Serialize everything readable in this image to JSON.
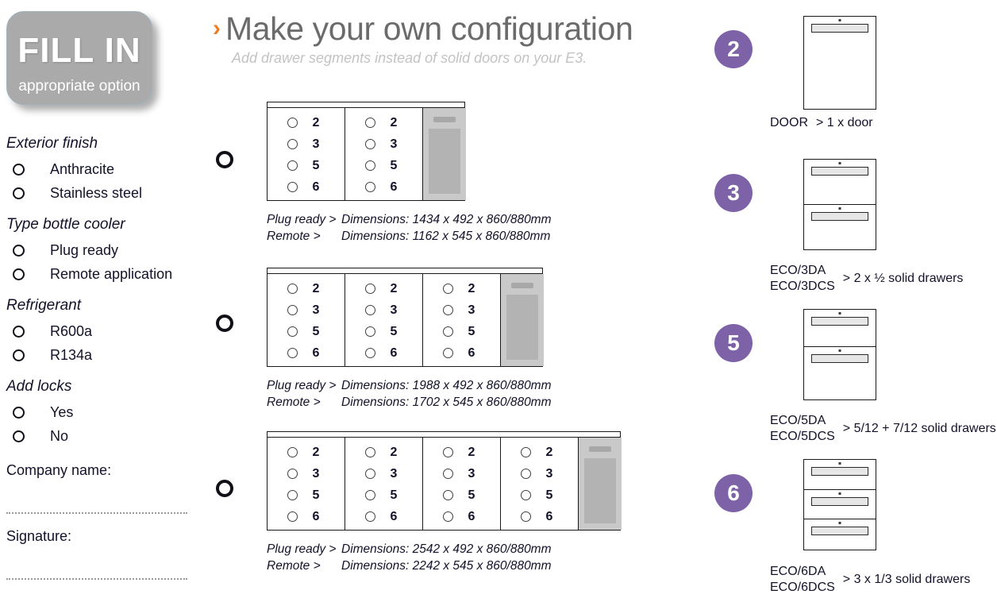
{
  "fill_in_badge": {
    "title": "FILL IN",
    "subtitle": "appropriate option"
  },
  "header": {
    "chevron_icon": "chevron-right-icon",
    "title": "Make your own configuration",
    "subtitle": "Add drawer segments instead of solid doors on your E3."
  },
  "form": {
    "groups": [
      {
        "title": "Exterior finish",
        "options": [
          "Anthracite",
          "Stainless steel"
        ]
      },
      {
        "title": "Type bottle cooler",
        "options": [
          "Plug ready",
          "Remote application"
        ]
      },
      {
        "title": "Refrigerant",
        "options": [
          "R600a",
          "R134a"
        ]
      },
      {
        "title": "Add locks",
        "options": [
          "Yes",
          "No"
        ]
      }
    ],
    "company_name_label": "Company name:",
    "signature_label": "Signature:"
  },
  "configurations": [
    {
      "id": "config-2-bay",
      "bays": 2,
      "bay_options": [
        "2",
        "3",
        "5",
        "6"
      ],
      "plug_ready_key": "Plug ready >",
      "plug_ready_value": "Dimensions: 1434 x 492 x 860/880mm",
      "remote_key": "Remote >",
      "remote_value": "Dimensions: 1162 x 545 x 860/880mm"
    },
    {
      "id": "config-3-bay",
      "bays": 3,
      "bay_options": [
        "2",
        "3",
        "5",
        "6"
      ],
      "plug_ready_key": "Plug ready >",
      "plug_ready_value": "Dimensions: 1988 x 492 x 860/880mm",
      "remote_key": "Remote >",
      "remote_value": "Dimensions: 1702 x 545 x 860/880mm"
    },
    {
      "id": "config-4-bay",
      "bays": 4,
      "bay_options": [
        "2",
        "3",
        "5",
        "6"
      ],
      "plug_ready_key": "Plug ready >",
      "plug_ready_value": "Dimensions: 2542 x 492 x 860/880mm",
      "remote_key": "Remote >",
      "remote_value": "Dimensions: 2242 x 545 x 860/880mm"
    }
  ],
  "legend": {
    "badge_color": "#7d62a8",
    "items": [
      {
        "number": "2",
        "segments": 1,
        "code_line1": "DOOR",
        "code_line2": "",
        "description": "> 1 x door"
      },
      {
        "number": "3",
        "segments": 2,
        "code_line1": "ECO/3DA",
        "code_line2": "ECO/3DCS",
        "description": "> 2 x ½ solid drawers"
      },
      {
        "number": "5",
        "segments": 2,
        "code_line1": "ECO/5DA",
        "code_line2": "ECO/5DCS",
        "description": "> 5/12 + 7/12 solid drawers"
      },
      {
        "number": "6",
        "segments": 3,
        "code_line1": "ECO/6DA",
        "code_line2": "ECO/6DCS",
        "description": "> 3 x 1/3 solid drawers"
      }
    ]
  },
  "colors": {
    "accent_orange": "#ef7d22",
    "badge_gray": "#aaaaaa",
    "legend_purple": "#7d62a8",
    "title_gray": "#6b6b6b",
    "subtitle_gray": "#c3c3c3"
  }
}
